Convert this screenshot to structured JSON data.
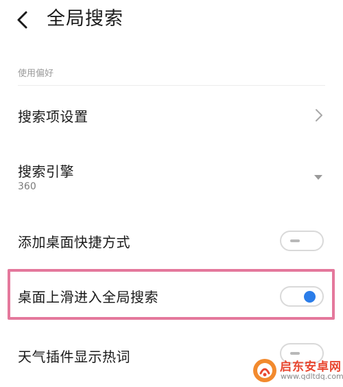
{
  "header": {
    "title": "全局搜索"
  },
  "preferences": {
    "section_label": "使用偏好",
    "search_items_settings": {
      "label": "搜索项设置"
    },
    "search_engine": {
      "label": "搜索引擎",
      "value": "360"
    },
    "add_desktop_shortcut": {
      "label": "添加桌面快捷方式",
      "enabled": false
    },
    "swipe_up_global_search": {
      "label": "桌面上滑进入全局搜索",
      "enabled": true
    },
    "weather_widget_hot_words": {
      "label": "天气插件显示热词",
      "enabled": false
    }
  },
  "highlight_color": "#e4789c",
  "toggle_on_color": "#2b7de9",
  "watermark": {
    "name": "启东安卓网",
    "url": "www.qdltdq.com"
  }
}
